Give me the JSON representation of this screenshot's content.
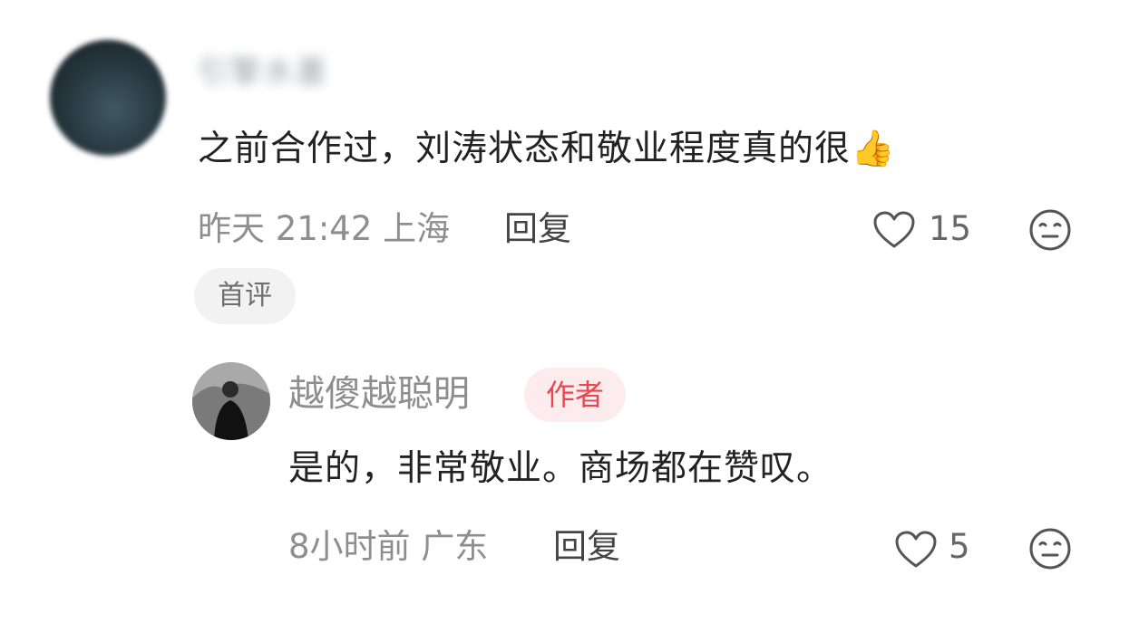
{
  "comment": {
    "username": "引擎水墨",
    "text": "之前合作过，刘涛状态和敬业程度真的很",
    "emoji": "👍",
    "time": "昨天 21:42",
    "location": "上海",
    "reply_label": "回复",
    "like_count": "15",
    "badge": "首评"
  },
  "reply": {
    "username": "越傻越聪明",
    "author_badge": "作者",
    "text": "是的，非常敬业。商场都在赞叹。",
    "time": "8小时前",
    "location": "广东",
    "reply_label": "回复",
    "like_count": "5"
  },
  "colors": {
    "author_badge_bg": "#fdecee",
    "author_badge_text": "#e8474f",
    "meta_gray": "#8e8e8e"
  },
  "icons": [
    "heart-outline-icon",
    "meh-face-icon",
    "thumbs-up-emoji"
  ]
}
